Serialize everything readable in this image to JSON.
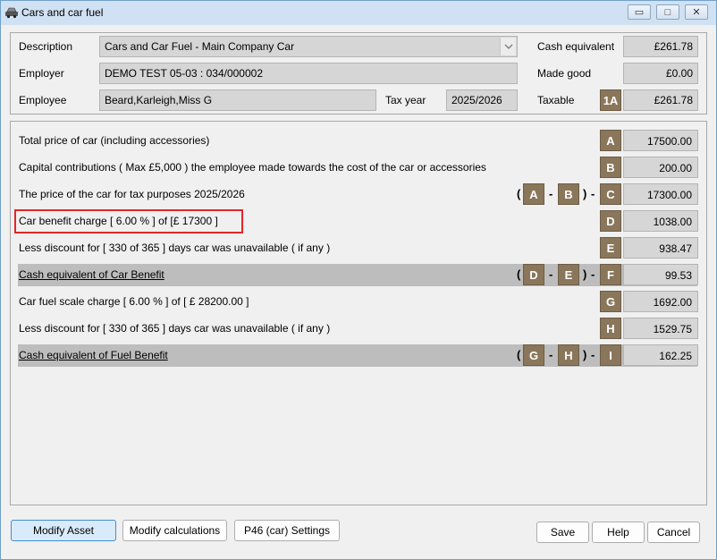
{
  "window": {
    "title": "Cars and car fuel",
    "minimize_glyph": "▭",
    "maximize_glyph": "□",
    "close_glyph": "✕"
  },
  "header": {
    "description_label": "Description",
    "description_value": "Cars and Car Fuel - Main Company Car",
    "employer_label": "Employer",
    "employer_value": "DEMO TEST 05-03 : 034/000002",
    "employee_label": "Employee",
    "employee_value": "Beard,Karleigh,Miss G",
    "tax_year_label": "Tax year",
    "tax_year_value": "2025/2026",
    "cash_equivalent_label": "Cash equivalent",
    "cash_equivalent_value": "£261.78",
    "made_good_label": "Made good",
    "made_good_value": "£0.00",
    "taxable_label": "Taxable",
    "taxable_badge": "1A",
    "taxable_value": "£261.78"
  },
  "rows": [
    {
      "label": "Total price of car (including accessories)",
      "badge": "A",
      "value": "17500.00"
    },
    {
      "label": "Capital contributions ( Max £5,000 ) the employee made towards the cost of the car or accessories",
      "badge": "B",
      "value": "200.00"
    },
    {
      "label": "The price of the car for tax purposes 2025/2026",
      "badge": "C",
      "value": "17300.00",
      "formula": {
        "open": "(",
        "left": "A",
        "op": "-",
        "right": "B",
        "close": ")",
        "minus": "-"
      }
    },
    {
      "label": "Car benefit charge [   6.00 % ] of [£      17300 ]",
      "badge": "D",
      "value": "1038.00"
    },
    {
      "label": "Less discount for [ 330 of 365 ] days car was unavailable ( if any )",
      "badge": "E",
      "value": "938.47"
    },
    {
      "label": "Cash equivalent of Car Benefit",
      "badge": "F",
      "value": "99.53",
      "formula": {
        "open": "(",
        "left": "D",
        "op": "-",
        "right": "E",
        "close": ")",
        "minus": "-"
      }
    },
    {
      "label": "Car fuel scale charge [   6.00 % ] of [  £   28200.00 ]",
      "badge": "G",
      "value": "1692.00"
    },
    {
      "label": "Less discount for [ 330 of 365 ] days car was unavailable ( if any )",
      "badge": "H",
      "value": "1529.75"
    },
    {
      "label": "Cash equivalent of Fuel Benefit",
      "badge": "I",
      "value": "162.25",
      "formula": {
        "open": "(",
        "left": "G",
        "op": "-",
        "right": "H",
        "close": ")",
        "minus": "-"
      }
    }
  ],
  "footer": {
    "modify_asset": "Modify Asset",
    "modify_calculations": "Modify calculations",
    "p46_settings": "P46 (car) Settings",
    "save": "Save",
    "help": "Help",
    "cancel": "Cancel"
  },
  "colors": {
    "badge": "#8a765a",
    "highlight": "#e32626",
    "shaded_row": "#bdbdbd"
  },
  "icons": {
    "title_icon": "car-icon",
    "dropdown_icon": "chevron-down-icon"
  }
}
